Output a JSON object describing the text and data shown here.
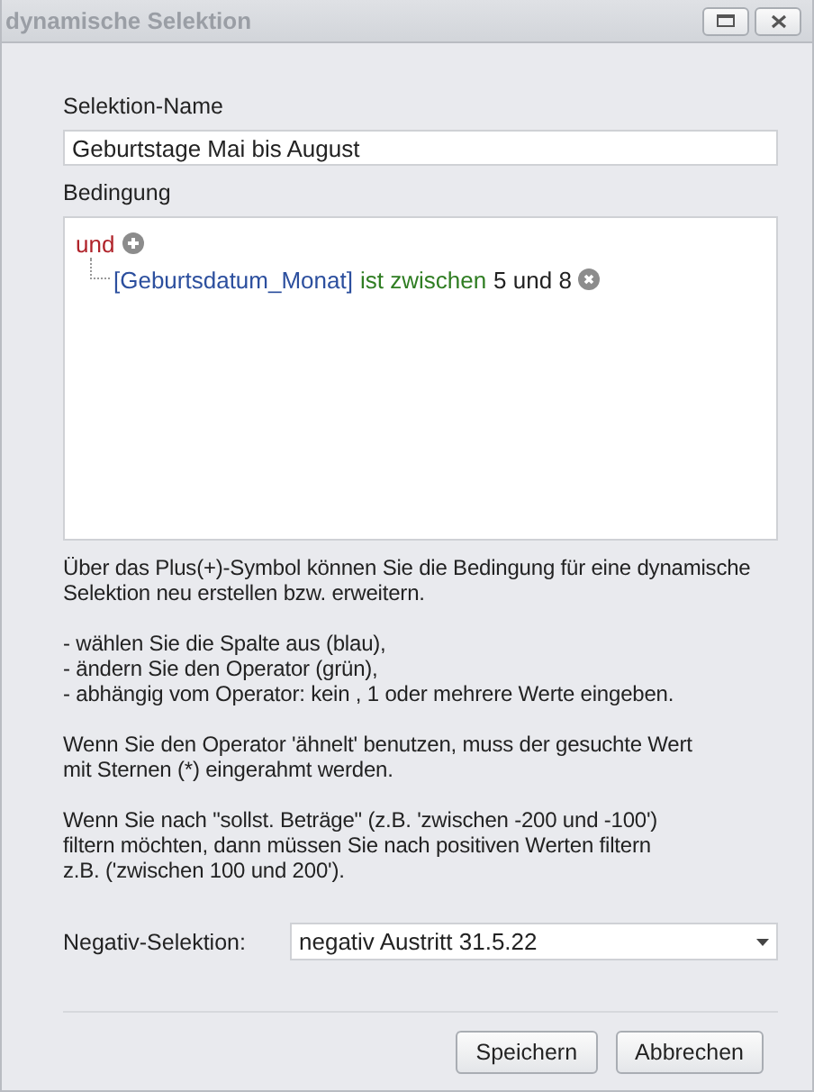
{
  "window": {
    "title": "dynamische Selektion",
    "controls": [
      {
        "kind": "maximize"
      },
      {
        "kind": "close"
      }
    ]
  },
  "name_field": {
    "label": "Selektion-Name",
    "value": "Geburtstage Mai bis August"
  },
  "condition": {
    "label": "Bedingung",
    "root": {
      "operator": "und",
      "children": [
        {
          "field": "[Geburtsdatum_Monat]",
          "operator": "ist zwischen",
          "values": "5 und 8"
        }
      ]
    }
  },
  "help": [
    [
      "Über das Plus(+)-Symbol können Sie die Bedingung für eine dynamische",
      "Selektion neu erstellen bzw. erweitern."
    ],
    [
      "- wählen Sie die Spalte aus (blau),",
      "- ändern Sie den Operator (grün),",
      "- abhängig vom Operator: kein , 1 oder mehrere Werte eingeben."
    ],
    [
      "Wenn Sie den Operator 'ähnelt' benutzen, muss der gesuchte Wert",
      "mit Sternen (*) eingerahmt werden."
    ],
    [
      "Wenn Sie nach \"sollst. Beträge\" (z.B. 'zwischen -200 und -100')",
      "filtern möchten, dann müssen Sie nach positiven Werten filtern",
      "z.B. ('zwischen 100 und 200')."
    ]
  ],
  "negative": {
    "label": "Negativ-Selektion:",
    "value": "negativ Austritt 31.5.22"
  },
  "buttons": [
    "Speichern",
    "Abbrechen"
  ]
}
